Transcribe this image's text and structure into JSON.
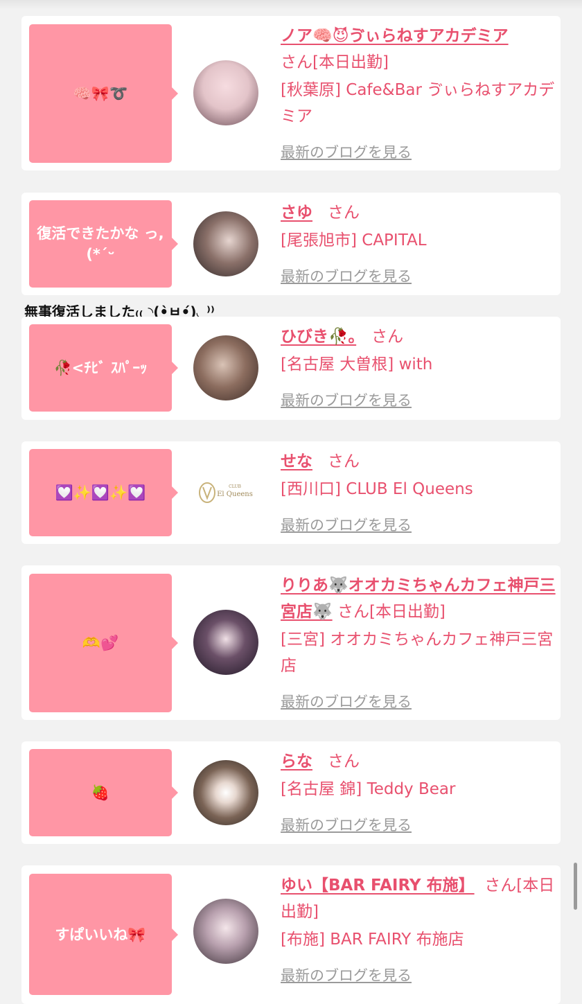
{
  "caption": "無事復活しました₍₍ ◝(•̀ㅂ•́)◟ ⁾⁾",
  "blog_label": "最新のブログを見る",
  "entries": [
    {
      "bubble": "🧠🎀➰",
      "name": "ノア🧠😈ゔぃらねすアカデミア",
      "suffix": "さん[本日出勤]",
      "shop": "[秋葉原] Cafe&Bar ゔぃらねすアカデミア"
    },
    {
      "bubble": "復活できたかな っ,(*ˊᵕ",
      "name": "さゆ",
      "suffix": "さん",
      "shop": "[尾張旭市] CAPITAL"
    },
    {
      "bubble": "🥀<ﾁﾋﾞ ｽﾊﾟｰｯ",
      "name": "ひびき🥀｡",
      "suffix": "さん",
      "shop": "[名古屋 大曽根] with"
    },
    {
      "bubble": "💟✨💟✨💟",
      "name": "せな",
      "suffix": "さん",
      "shop": "[西川口] CLUB El Queens"
    },
    {
      "bubble": "🫶💕",
      "name": "りりあ🐺オオカミちゃんカフェ神戸三宮店🐺",
      "suffix": "さん[本日出勤]",
      "shop": "[三宮] オオカミちゃんカフェ神戸三宮店"
    },
    {
      "bubble": "🍓",
      "name": "らな",
      "suffix": "さん",
      "shop": "[名古屋 錦] Teddy Bear"
    },
    {
      "bubble": "すぱいいね🎀",
      "name": "ゆい【BAR FAIRY 布施】",
      "suffix": "さん[本日出勤]",
      "shop": "[布施] BAR FAIRY 布施店"
    }
  ],
  "logo": {
    "small": "CLUB",
    "big": "El Queens"
  }
}
